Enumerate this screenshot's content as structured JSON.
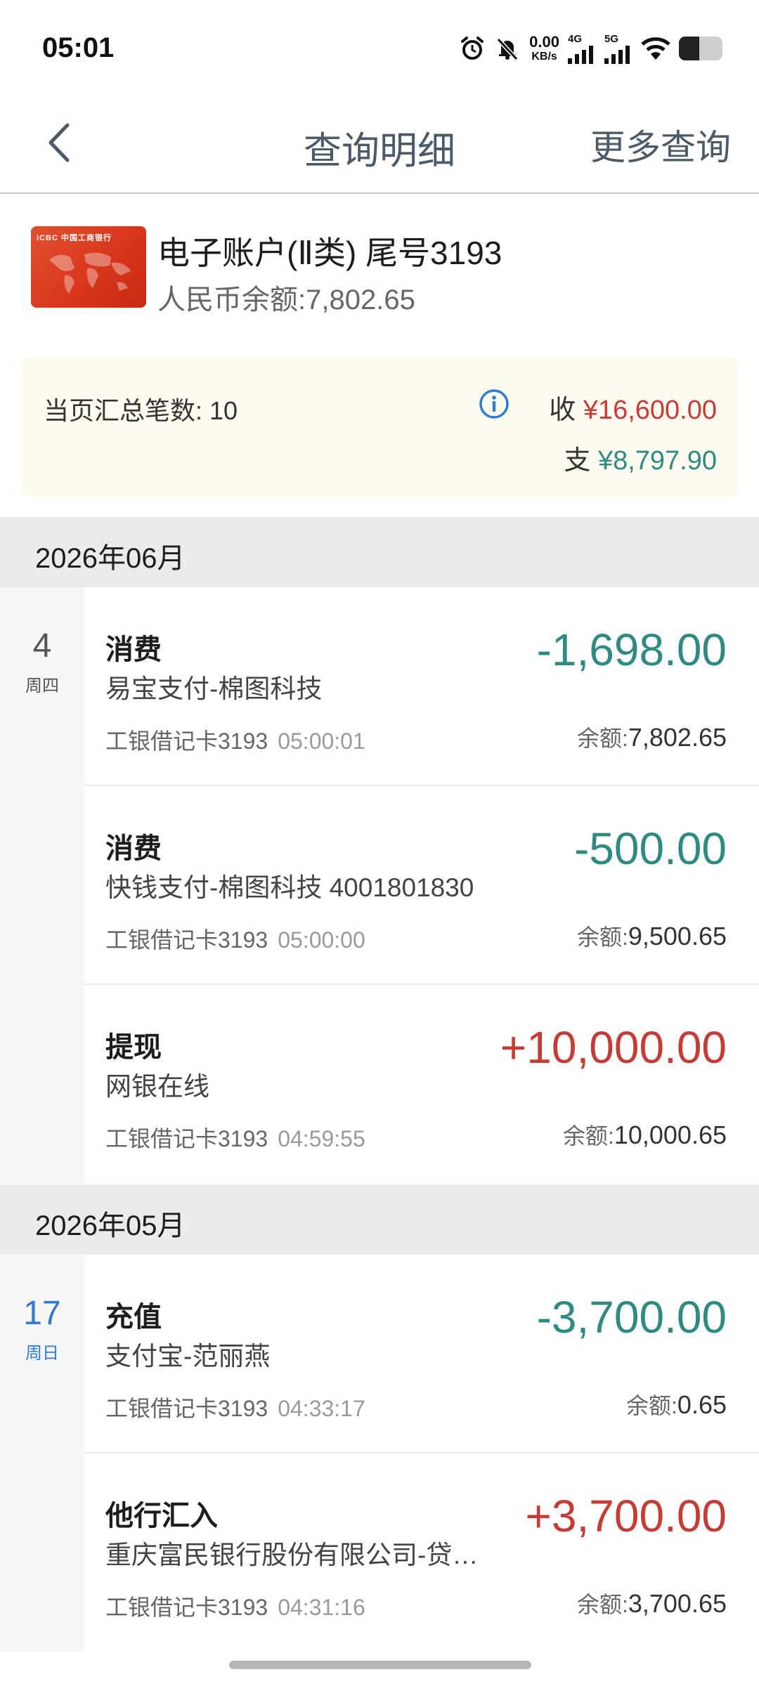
{
  "status_bar": {
    "time": "05:01",
    "net_speed_value": "0.00",
    "net_speed_unit": "KB/s",
    "signal1_label": "4G",
    "signal2_label": "5G",
    "battery_level": 0.46
  },
  "nav": {
    "title": "查询明细",
    "more": "更多查询"
  },
  "account": {
    "card_brand": "ICBC 中国工商银行",
    "name": "电子账户(Ⅱ类)  尾号3193",
    "balance": "人民币余额:7,802.65"
  },
  "summary": {
    "count": "当页汇总笔数: 10",
    "income_label": "收",
    "income_amount": "¥16,600.00",
    "expense_label": "支",
    "expense_amount": "¥8,797.90"
  },
  "months": [
    {
      "label": "2026年06月",
      "day": "4",
      "weekday": "周四",
      "transactions": [
        {
          "type": "消费",
          "desc": "易宝支付-棉图科技",
          "card": "工银借记卡3193",
          "time": "05:00:01",
          "amount": "-1,698.00",
          "balance_label": "余额:",
          "balance": "7,802.65"
        },
        {
          "type": "消费",
          "desc": "快钱支付-棉图科技 4001801830",
          "card": "工银借记卡3193",
          "time": "05:00:00",
          "amount": "-500.00",
          "balance_label": "余额:",
          "balance": "9,500.65"
        },
        {
          "type": "提现",
          "desc": "网银在线",
          "card": "工银借记卡3193",
          "time": "04:59:55",
          "amount": "+10,000.00",
          "balance_label": "余额:",
          "balance": "10,000.65"
        }
      ]
    },
    {
      "label": "2026年05月",
      "day": "17",
      "weekday": "周日",
      "transactions": [
        {
          "type": "充值",
          "desc": "支付宝-范丽燕",
          "card": "工银借记卡3193",
          "time": "04:33:17",
          "amount": "-3,700.00",
          "balance_label": "余额:",
          "balance": "0.65"
        },
        {
          "type": "他行汇入",
          "desc": "重庆富民银行股份有限公司-贷…",
          "card": "工银借记卡3193",
          "time": "04:31:16",
          "amount": "+3,700.00",
          "balance_label": "余额:",
          "balance": "3,700.65"
        }
      ]
    }
  ],
  "colors": {
    "income": "#c73b35",
    "expense": "#2d8b81",
    "sunday": "#2f7bd1"
  }
}
